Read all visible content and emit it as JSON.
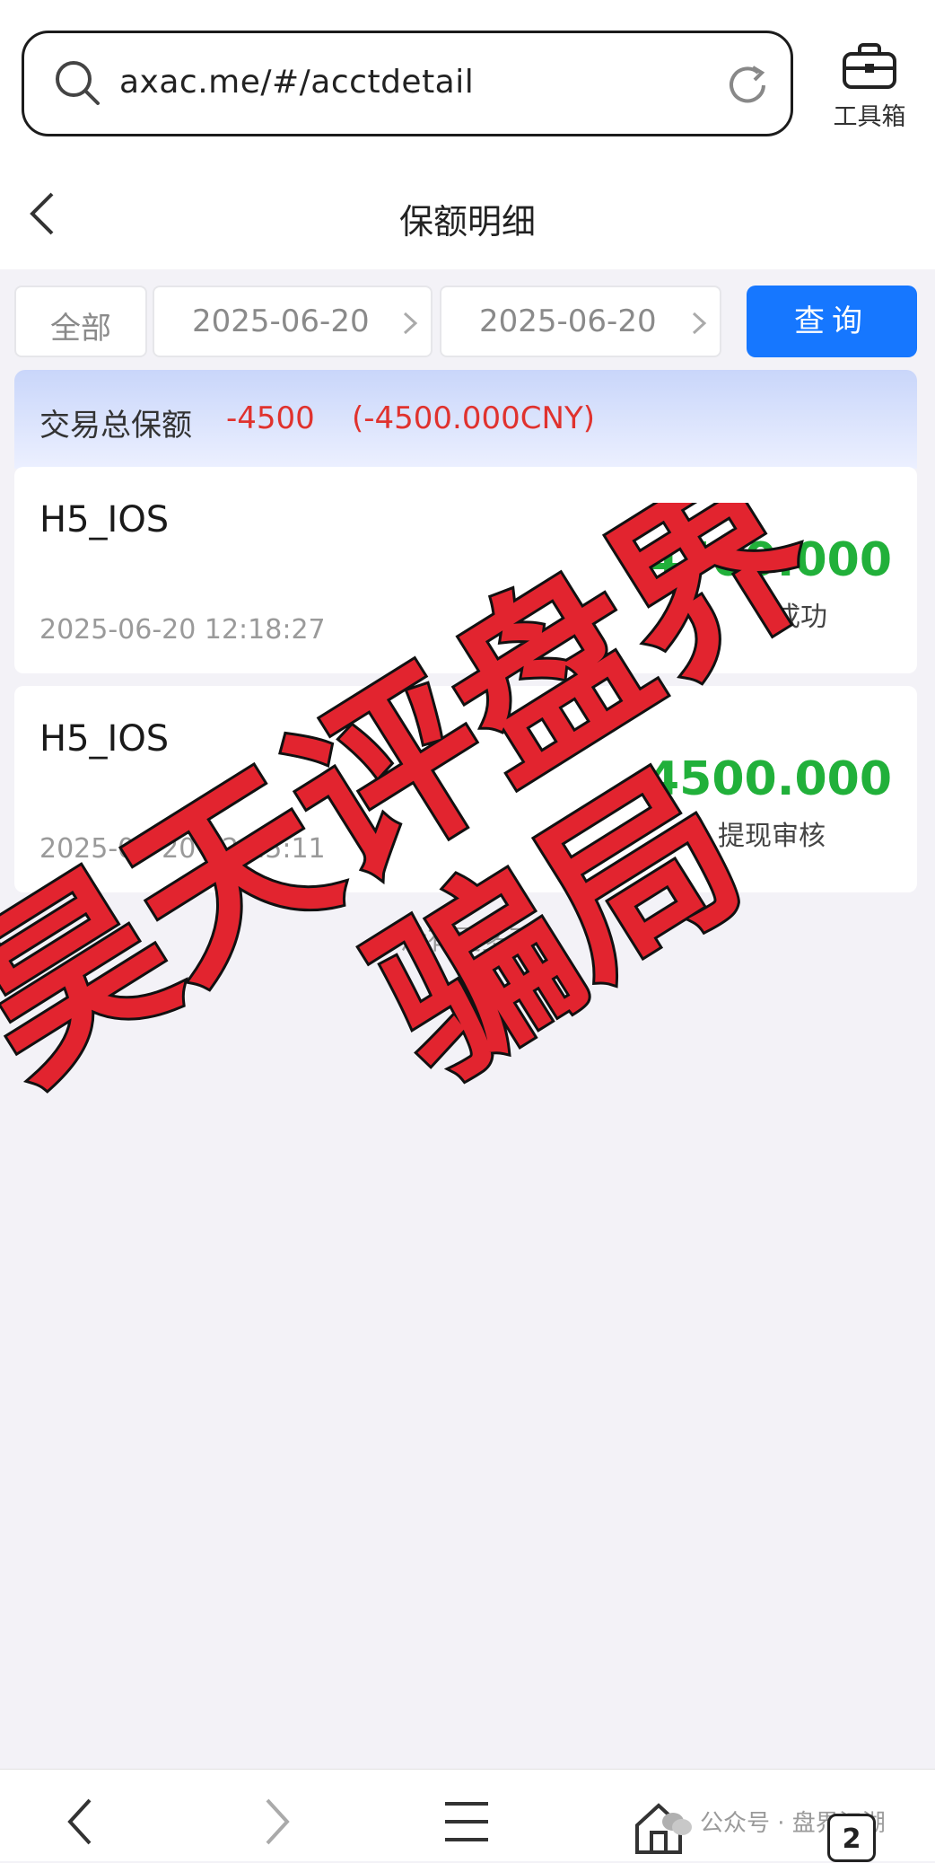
{
  "browser": {
    "url": "axac.me/#/acctdetail",
    "toolbox_label": "工具箱"
  },
  "nav": {
    "title": "保额明细"
  },
  "filters": {
    "type": "全部",
    "start_date": "2025-06-20",
    "end_date": "2025-06-20",
    "query_label": "查询"
  },
  "summary": {
    "label": "交易总保额",
    "value": "-4500",
    "converted": "(-4500.000CNY)"
  },
  "records": [
    {
      "source": "H5_IOS",
      "amount": "-4500.000",
      "status": "成功",
      "time": "2025-06-20 12:18:27"
    },
    {
      "source": "H5_IOS",
      "amount": "4500.000",
      "status": "提现审核",
      "time": "2025-06-20 12:15:11"
    }
  ],
  "list_end_text": "没有更多了",
  "overlay": {
    "line1": "昊天评盘界",
    "line2": "骗局"
  },
  "bottom": {
    "tab_count": "2",
    "watermark": "公众号 · 盘界江湖"
  },
  "colors": {
    "accent": "#1677ff",
    "negative": "#e0322e",
    "amount": "#21b03a",
    "stamp": "#e2242f"
  }
}
